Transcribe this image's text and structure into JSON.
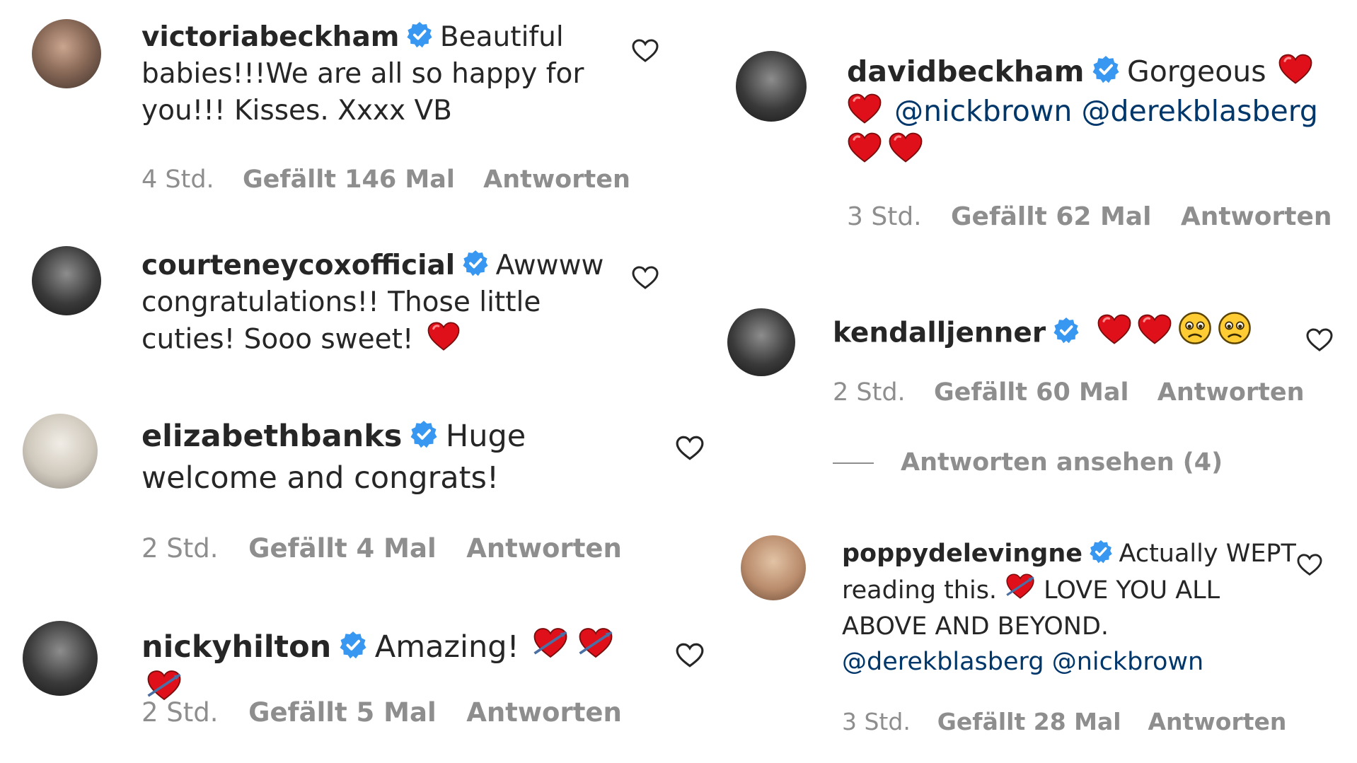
{
  "colors": {
    "username": "#262626",
    "meta": "#8e8e8e",
    "mention": "#00376b",
    "verified": "#3897f0",
    "heart": "#e0101b"
  },
  "comments": [
    {
      "username": "victoriabeckham",
      "text": "Beautiful babies!!!We are all so happy for you!!! Kisses. Xxxx VB",
      "time": "4 Std.",
      "likes": "Gefällt 146 Mal",
      "reply": "Antworten"
    },
    {
      "username": "courteneycoxofficial",
      "text": "Awwww congratulations!! Those little cuties! Sooo sweet!",
      "time": "",
      "likes": "",
      "reply": ""
    },
    {
      "username": "elizabethbanks",
      "text": "Huge welcome and congrats!",
      "time": "2 Std.",
      "likes": "Gefällt 4 Mal",
      "reply": "Antworten"
    },
    {
      "username": "nickyhilton",
      "text": "Amazing!",
      "time": "2 Std.",
      "likes": "Gefällt 5 Mal",
      "reply": "Antworten"
    },
    {
      "username": "davidbeckham",
      "text": "Gorgeous",
      "mentions": [
        "@nickbrown",
        "@derekblasberg"
      ],
      "time": "3 Std.",
      "likes": "Gefällt 62 Mal",
      "reply": "Antworten"
    },
    {
      "username": "kendalljenner",
      "time": "2 Std.",
      "likes": "Gefällt 60 Mal",
      "reply": "Antworten",
      "view_replies": "Antworten ansehen (4)"
    },
    {
      "username": "poppydelevingne",
      "text_a": "Actually WEPT reading this.",
      "text_b": "LOVE YOU ALL ABOVE AND BEYOND.",
      "mentions": [
        "@derekblasberg",
        "@nickbrown"
      ],
      "time": "3 Std.",
      "likes": "Gefällt 28 Mal",
      "reply": "Antworten"
    }
  ]
}
